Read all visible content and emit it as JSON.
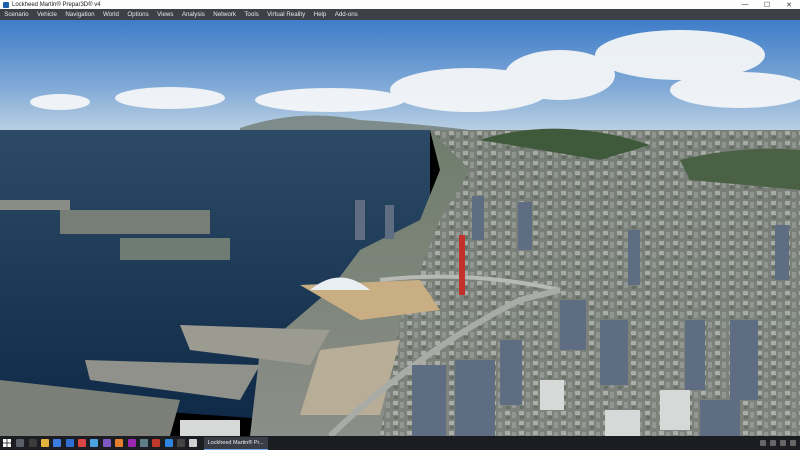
{
  "window": {
    "title": "Lockheed Martin® Prepar3D® v4",
    "minimize_glyph": "—",
    "maximize_glyph": "☐",
    "close_glyph": "✕"
  },
  "menubar": {
    "items": [
      "Scenario",
      "Vehicle",
      "Navigation",
      "World",
      "Options",
      "Views",
      "Analysis",
      "Network",
      "Tools",
      "Virtual Reality",
      "Help",
      "Add-ons"
    ]
  },
  "viewport": {
    "description_icon": "flight-sim-scene"
  },
  "taskbar": {
    "start_icon": "windows-start-icon",
    "active_app_label": "Lockheed Martin® Pr...",
    "pinned_colors": [
      "#5a5f6a",
      "#3c3c3c",
      "#e2b13c",
      "#3b7de0",
      "#2f6fd3",
      "#d94545",
      "#4aa3df",
      "#7e57c2",
      "#e57f2f",
      "#9c27b0",
      "#607d8b",
      "#c0392b",
      "#2e86de",
      "#444",
      "#d0d0d0",
      "#1e88e5",
      "#4caf50",
      "#ff9800",
      "#ef5350",
      "#555"
    ]
  }
}
